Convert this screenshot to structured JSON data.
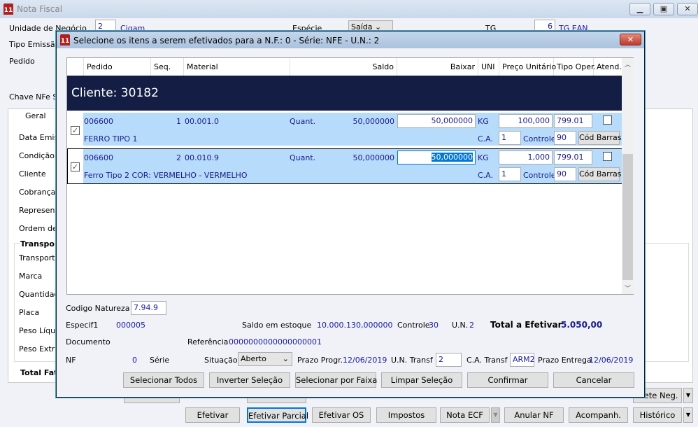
{
  "window": {
    "title": "Nota Fiscal",
    "logo": "11"
  },
  "form": {
    "unidade_label": "Unidade de Negócio",
    "unidade_value": "2",
    "unidade_name": "Cigam",
    "especie_label": "Espécie",
    "especie_value": "Saída",
    "tg_label": "TG",
    "tg_value": "6",
    "tg_name": "TG EAN",
    "tipo_emissao_label": "Tipo Emissão",
    "pedido_label": "Pedido",
    "chave_label": "Chave NFe SE"
  },
  "tabs": {
    "geral": "Geral"
  },
  "left_fields": [
    "Data Emiss",
    "Condição d",
    "Cliente",
    "Cobrança",
    "Representa",
    "Ordem de"
  ],
  "transport": {
    "title": "Transpor",
    "fields": [
      "Transporta",
      "Marca",
      "Quantidade",
      "Placa",
      "Peso Líquid",
      "Peso Extra"
    ]
  },
  "total_fat": "Total Fat",
  "dialog": {
    "title": "Selecione os itens a serem efetivados para a N.F.: 0 - Série: NFE - U.N.: 2",
    "columns": {
      "pedido": "Pedido",
      "seq": "Seq.",
      "material": "Material",
      "saldo": "Saldo",
      "baixar": "Baixar",
      "uni": "UNI",
      "preco": "Preço Unitário",
      "tipo_oper": "Tipo Oper.",
      "atend": "Atend."
    },
    "cliente": "Cliente: 30182",
    "rows": [
      {
        "checked": true,
        "pedido": "006600",
        "seq": "1",
        "material": "00.001.0",
        "quant_label": "Quant.",
        "saldo": "50,000000",
        "baixar": "50,000000",
        "uni": "KG",
        "preco": "100,000",
        "tipo_oper": "799.01",
        "atend": false,
        "descricao": "FERRO TIPO 1",
        "ca_label": "C.A.",
        "ca": "1",
        "controle_label": "Controle",
        "controle": "90",
        "cod_barras": "Cód Barras"
      },
      {
        "checked": true,
        "pedido": "006600",
        "seq": "2",
        "material": "00.010.9",
        "quant_label": "Quant.",
        "saldo": "50,000000",
        "baixar": "50,000000",
        "uni": "KG",
        "preco": "1,000",
        "tipo_oper": "799.01",
        "atend": false,
        "descricao": "Ferro Tipo 2 COR: VERMELHO - VERMELHO",
        "ca_label": "C.A.",
        "ca": "1",
        "controle_label": "Controle",
        "controle": "90",
        "cod_barras": "Cód Barras"
      }
    ],
    "codigo_natureza_label": "Codigo Natureza",
    "codigo_natureza": "7.94.9",
    "especif1_label": "Especif1",
    "especif1": "000005",
    "saldo_estoque_label": "Saldo em estoque",
    "saldo_estoque": "10.000.130,000000",
    "controle_label": "Controle",
    "controle": "30",
    "un_label": "U.N.",
    "un": "2",
    "total_label": "Total a Efetivar",
    "total": "5.050,00",
    "documento_label": "Documento",
    "referencia_label": "Referência",
    "referencia": "0000000000000000001",
    "nf_label": "NF",
    "nf": "0",
    "serie_label": "Série",
    "situacao_label": "Situação",
    "situacao": "Aberto",
    "prazo_progr_label": "Prazo Progr.",
    "prazo_progr": "12/06/2019",
    "un_transf_label": "U.N. Transf",
    "un_transf": "2",
    "ca_transf_label": "C.A. Transf",
    "ca_transf": "ARM2",
    "prazo_entrega_label": "Prazo Entrega",
    "prazo_entrega": "12/06/2019",
    "buttons": {
      "selecionar_todos": "Selecionar Todos",
      "inverter": "Inverter Seleção",
      "por_faixa": "Selecionar por Faixa",
      "limpar": "Limpar Seleção",
      "confirmar": "Confirmar",
      "cancelar": "Cancelar"
    }
  },
  "bottom": {
    "frete": "Frete Neg.",
    "efetivar": "Efetivar",
    "efetivar_parcial": "Efetivar Parcial",
    "efetivar_os": "Efetivar OS",
    "impostos": "Impostos",
    "nota_ecf": "Nota ECF",
    "anular": "Anular NF",
    "acompanh": "Acompanh.",
    "historico": "Histórico"
  }
}
